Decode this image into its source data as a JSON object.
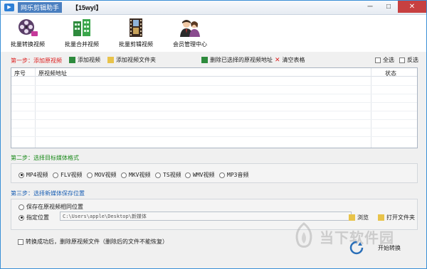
{
  "window": {
    "title": "网乐剪辑助手",
    "code": "【15wyl】",
    "minimize": "─",
    "maximize": "□",
    "close": "✕"
  },
  "toolbar": {
    "items": [
      {
        "label": "批量转换视频",
        "icon": "film-reel-icon"
      },
      {
        "label": "批量合并视频",
        "icon": "merge-building-icon"
      },
      {
        "label": "批量剪辑视频",
        "icon": "film-strip-icon"
      },
      {
        "label": "会员管理中心",
        "icon": "users-icon"
      }
    ]
  },
  "step1": {
    "label": "第一步：添加原视频",
    "add_video": "添加视频",
    "add_folder": "添加视频文件夹",
    "delete_selected": "删除已选择的原视频地址",
    "clear_table": "清空表格",
    "select_all": "全选",
    "invert": "反选"
  },
  "table": {
    "columns": [
      "序号",
      "原视频地址",
      "状态"
    ]
  },
  "step2": {
    "label": "第二步：选择目标媒体格式",
    "formats": [
      "MP4视频",
      "FLV视频",
      "MOV视频",
      "MKV视频",
      "TS视频",
      "WMV视频",
      "MP3音频"
    ],
    "selected": "MP4视频"
  },
  "step3": {
    "label": "第三步：选择新媒体保存位置",
    "option_same": "保存在原视频相同位置",
    "option_custom": "指定位置",
    "path": "C:\\Users\\apple\\Desktop\\新媒体",
    "browse": "浏览",
    "open_folder": "打开文件夹"
  },
  "footer": {
    "delete_after": "转换成功后，删除原视频文件（删除后的文件不能恢复）",
    "start": "开始转换",
    "watermark": "当下软件园"
  },
  "colors": {
    "step1": "#dd2222",
    "step2": "#1a8a1a",
    "step3": "#1a5fb4"
  }
}
